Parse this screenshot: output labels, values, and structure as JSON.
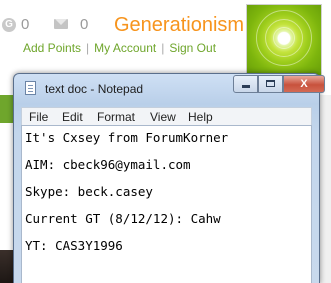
{
  "forum": {
    "gc_icon": "G",
    "gc_count": "0",
    "mail_count": "0",
    "site_name": "Generationism",
    "links": [
      "Add Points",
      "My Account",
      "Sign Out"
    ],
    "separator": "|"
  },
  "notepad": {
    "title": "text doc - Notepad",
    "buttons": {
      "minimize": "",
      "maximize": "",
      "close": "X"
    },
    "menu": [
      "File",
      "Edit",
      "Format",
      "View",
      "Help"
    ],
    "lines": [
      "It's Cxsey from ForumKorner",
      "AIM: cbeck96@ymail.com",
      "Skype: beck.casey",
      "Current GT (8/12/12): Cahw",
      "YT: CAS3Y1996"
    ]
  },
  "colors": {
    "brand_orange": "#f7941d",
    "link_green": "#6fa62c",
    "close_red": "#c8523d"
  },
  "icons": {
    "gc": "gc-icon",
    "mail": "mail-icon",
    "doc": "notepad-doc-icon",
    "avatar": "green-radial-avatar"
  }
}
